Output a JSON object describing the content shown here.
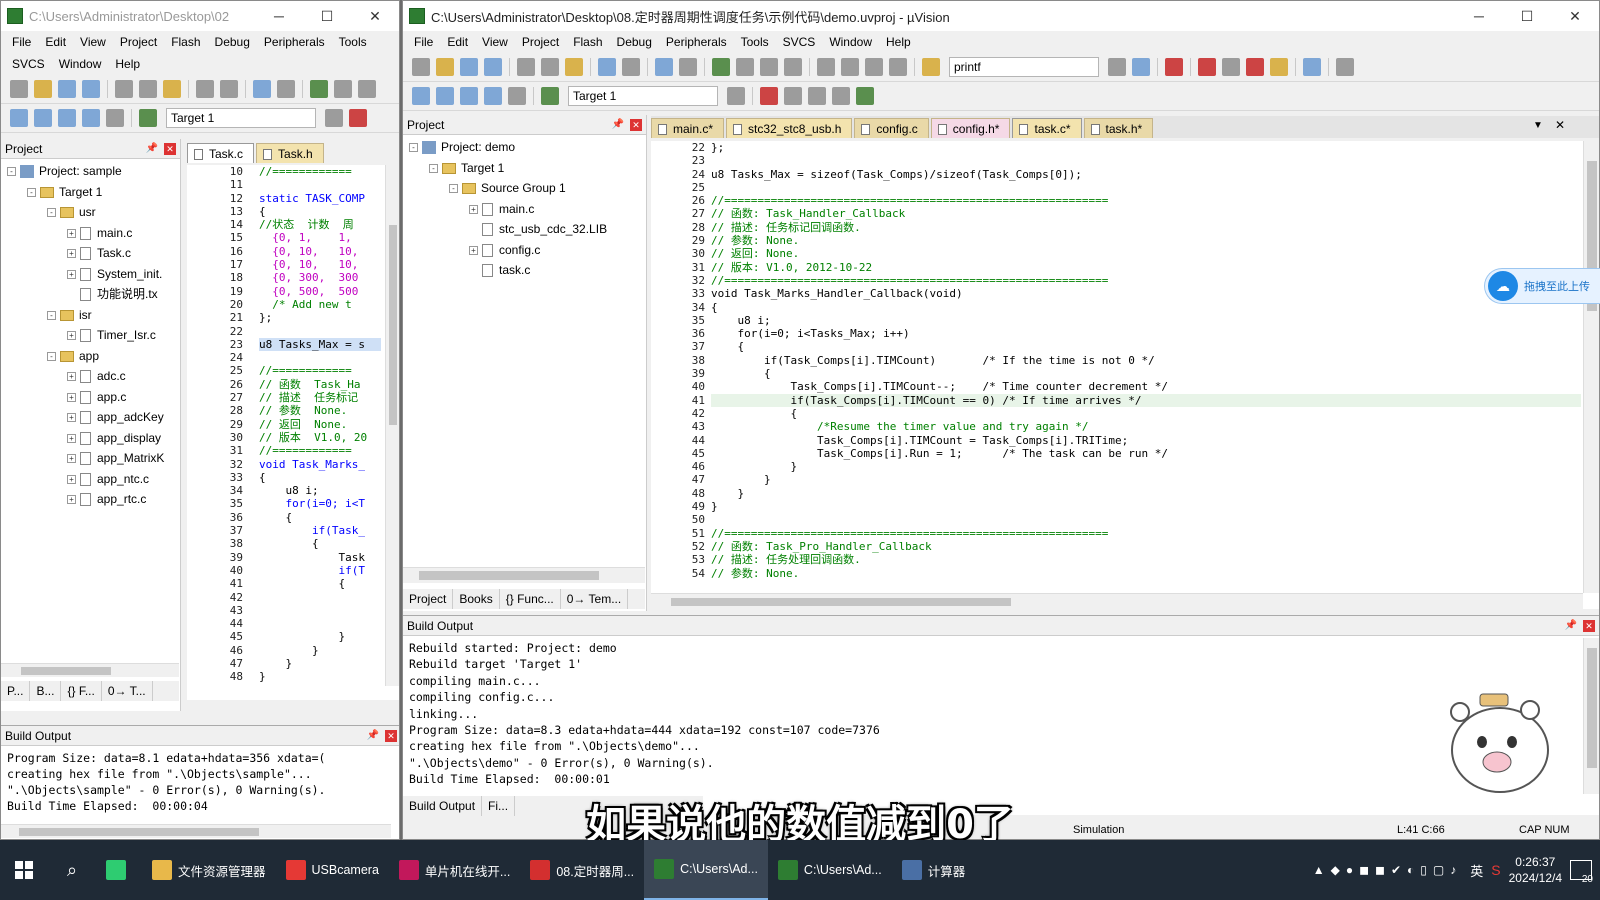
{
  "left_window": {
    "title": "C:\\Users\\Administrator\\Desktop\\02",
    "menu": [
      "File",
      "Edit",
      "View",
      "Project",
      "Flash",
      "Debug",
      "Peripherals",
      "Tools",
      "SVCS",
      "Window",
      "Help"
    ],
    "target": "Target 1",
    "project_panel_title": "Project",
    "tree": [
      {
        "label": "Project: sample",
        "level": 0,
        "kind": "proj",
        "exp": "-"
      },
      {
        "label": "Target 1",
        "level": 1,
        "kind": "fold",
        "exp": "-"
      },
      {
        "label": "usr",
        "level": 2,
        "kind": "fold",
        "exp": "-"
      },
      {
        "label": "main.c",
        "level": 3,
        "kind": "file",
        "exp": "+"
      },
      {
        "label": "Task.c",
        "level": 3,
        "kind": "file",
        "exp": "+"
      },
      {
        "label": "System_init.",
        "level": 3,
        "kind": "file",
        "exp": "+"
      },
      {
        "label": "功能说明.tx",
        "level": 3,
        "kind": "file",
        "exp": ""
      },
      {
        "label": "isr",
        "level": 2,
        "kind": "fold",
        "exp": "-"
      },
      {
        "label": "Timer_Isr.c",
        "level": 3,
        "kind": "file",
        "exp": "+"
      },
      {
        "label": "app",
        "level": 2,
        "kind": "fold",
        "exp": "-"
      },
      {
        "label": "adc.c",
        "level": 3,
        "kind": "file",
        "exp": "+"
      },
      {
        "label": "app.c",
        "level": 3,
        "kind": "file",
        "exp": "+"
      },
      {
        "label": "app_adcKey",
        "level": 3,
        "kind": "file",
        "exp": "+"
      },
      {
        "label": "app_display",
        "level": 3,
        "kind": "file",
        "exp": "+"
      },
      {
        "label": "app_MatrixK",
        "level": 3,
        "kind": "file",
        "exp": "+"
      },
      {
        "label": "app_ntc.c",
        "level": 3,
        "kind": "file",
        "exp": "+"
      },
      {
        "label": "app_rtc.c",
        "level": 3,
        "kind": "file",
        "exp": "+"
      }
    ],
    "bottom_tabs": [
      "P...",
      "B...",
      "{} F...",
      "0→ T..."
    ],
    "editor_tabs": [
      "Task.c",
      "Task.h"
    ],
    "code_lines": [
      {
        "n": "10",
        "t": "//============",
        "c": "cm"
      },
      {
        "n": "11",
        "t": "",
        "c": ""
      },
      {
        "n": "12",
        "t": "static TASK_COMP",
        "c": "kw"
      },
      {
        "n": "13",
        "t": "{",
        "c": ""
      },
      {
        "n": "14",
        "t": "//状态  计数  周",
        "c": "cm"
      },
      {
        "n": "15",
        "t": "  {0, 1,    1,",
        "c": "ks"
      },
      {
        "n": "16",
        "t": "  {0, 10,   10,",
        "c": "ks"
      },
      {
        "n": "17",
        "t": "  {0, 10,   10,",
        "c": "ks"
      },
      {
        "n": "18",
        "t": "  {0, 300,  300",
        "c": "ks"
      },
      {
        "n": "19",
        "t": "  {0, 500,  500",
        "c": "ks"
      },
      {
        "n": "20",
        "t": "  /* Add new t",
        "c": "cm"
      },
      {
        "n": "21",
        "t": "};",
        "c": ""
      },
      {
        "n": "22",
        "t": "",
        "c": ""
      },
      {
        "n": "23",
        "t": "u8 Tasks_Max = s",
        "c": "sel"
      },
      {
        "n": "24",
        "t": "",
        "c": ""
      },
      {
        "n": "25",
        "t": "//============",
        "c": "cm"
      },
      {
        "n": "26",
        "t": "// 函数  Task_Ha",
        "c": "cm"
      },
      {
        "n": "27",
        "t": "// 描述  任务标记",
        "c": "cm"
      },
      {
        "n": "28",
        "t": "// 参数  None.",
        "c": "cm"
      },
      {
        "n": "29",
        "t": "// 返回  None.",
        "c": "cm"
      },
      {
        "n": "30",
        "t": "// 版本  V1.0, 20",
        "c": "cm"
      },
      {
        "n": "31",
        "t": "//============",
        "c": "cm"
      },
      {
        "n": "32",
        "t": "void Task_Marks_",
        "c": "kw"
      },
      {
        "n": "33",
        "t": "{",
        "c": ""
      },
      {
        "n": "34",
        "t": "    u8 i;",
        "c": ""
      },
      {
        "n": "35",
        "t": "    for(i=0; i<T",
        "c": "kw"
      },
      {
        "n": "36",
        "t": "    {",
        "c": ""
      },
      {
        "n": "37",
        "t": "        if(Task_",
        "c": "kw"
      },
      {
        "n": "38",
        "t": "        {",
        "c": ""
      },
      {
        "n": "39",
        "t": "            Task",
        "c": ""
      },
      {
        "n": "40",
        "t": "            if(T",
        "c": "kw"
      },
      {
        "n": "41",
        "t": "            {",
        "c": ""
      },
      {
        "n": "42",
        "t": "",
        "c": ""
      },
      {
        "n": "43",
        "t": "",
        "c": ""
      },
      {
        "n": "44",
        "t": "",
        "c": ""
      },
      {
        "n": "45",
        "t": "            }",
        "c": ""
      },
      {
        "n": "46",
        "t": "        }",
        "c": ""
      },
      {
        "n": "47",
        "t": "    }",
        "c": ""
      },
      {
        "n": "48",
        "t": "}",
        "c": ""
      }
    ],
    "build_title": "Build Output",
    "build_lines": [
      "Program Size: data=8.1 edata+hdata=356 xdata=(",
      "creating hex file from \".\\Objects\\sample\"...",
      "\".\\Objects\\sample\" - 0 Error(s), 0 Warning(s).",
      "Build Time Elapsed:  00:00:04"
    ]
  },
  "right_window": {
    "title": "C:\\Users\\Administrator\\Desktop\\08.定时器周期性调度任务\\示例代码\\demo.uvproj - µVision",
    "menu": [
      "File",
      "Edit",
      "View",
      "Project",
      "Flash",
      "Debug",
      "Peripherals",
      "Tools",
      "SVCS",
      "Window",
      "Help"
    ],
    "find_combo": "printf",
    "target": "Target 1",
    "project_panel_title": "Project",
    "tree": [
      {
        "label": "Project: demo",
        "level": 0,
        "kind": "proj",
        "exp": "-"
      },
      {
        "label": "Target 1",
        "level": 1,
        "kind": "fold",
        "exp": "-"
      },
      {
        "label": "Source Group 1",
        "level": 2,
        "kind": "fold",
        "exp": "-"
      },
      {
        "label": "main.c",
        "level": 3,
        "kind": "file",
        "exp": "+"
      },
      {
        "label": "stc_usb_cdc_32.LIB",
        "level": 3,
        "kind": "file",
        "exp": ""
      },
      {
        "label": "config.c",
        "level": 3,
        "kind": "file",
        "exp": "+"
      },
      {
        "label": "task.c",
        "level": 3,
        "kind": "file",
        "exp": ""
      }
    ],
    "bottom_tabs": [
      "Project",
      "Books",
      "{} Func...",
      "0→ Tem..."
    ],
    "editor_tabs": [
      "main.c*",
      "stc32_stc8_usb.h",
      "config.c",
      "config.h*",
      "task.c*",
      "task.h*"
    ],
    "code_lines": [
      {
        "n": "22",
        "t": "};",
        "c": ""
      },
      {
        "n": "23",
        "t": "",
        "c": ""
      },
      {
        "n": "24",
        "t": "u8 Tasks_Max = sizeof(Task_Comps)/sizeof(Task_Comps[0]);",
        "c": ""
      },
      {
        "n": "25",
        "t": "",
        "c": ""
      },
      {
        "n": "26",
        "t": "//==========================================================",
        "c": "cm"
      },
      {
        "n": "27",
        "t": "// 函数: Task_Handler_Callback",
        "c": "cm"
      },
      {
        "n": "28",
        "t": "// 描述: 任务标记回调函数.",
        "c": "cm"
      },
      {
        "n": "29",
        "t": "// 参数: None.",
        "c": "cm"
      },
      {
        "n": "30",
        "t": "// 返回: None.",
        "c": "cm"
      },
      {
        "n": "31",
        "t": "// 版本: V1.0, 2012-10-22",
        "c": "cm"
      },
      {
        "n": "32",
        "t": "//==========================================================",
        "c": "cm"
      },
      {
        "n": "33",
        "t": "void Task_Marks_Handler_Callback(void)",
        "c": ""
      },
      {
        "n": "34",
        "t": "{",
        "c": ""
      },
      {
        "n": "35",
        "t": "    u8 i;",
        "c": ""
      },
      {
        "n": "36",
        "t": "    for(i=0; i<Tasks_Max; i++)",
        "c": ""
      },
      {
        "n": "37",
        "t": "    {",
        "c": ""
      },
      {
        "n": "38",
        "t": "        if(Task_Comps[i].TIMCount)       /* If the time is not 0 */",
        "c": ""
      },
      {
        "n": "39",
        "t": "        {",
        "c": ""
      },
      {
        "n": "40",
        "t": "            Task_Comps[i].TIMCount--;    /* Time counter decrement */",
        "c": ""
      },
      {
        "n": "41",
        "t": "            if(Task_Comps[i].TIMCount == 0) /* If time arrives */",
        "c": "hl"
      },
      {
        "n": "42",
        "t": "            {",
        "c": ""
      },
      {
        "n": "43",
        "t": "                /*Resume the timer value and try again */",
        "c": "cm"
      },
      {
        "n": "44",
        "t": "                Task_Comps[i].TIMCount = Task_Comps[i].TRITime;",
        "c": ""
      },
      {
        "n": "45",
        "t": "                Task_Comps[i].Run = 1;      /* The task can be run */",
        "c": ""
      },
      {
        "n": "46",
        "t": "            }",
        "c": ""
      },
      {
        "n": "47",
        "t": "        }",
        "c": ""
      },
      {
        "n": "48",
        "t": "    }",
        "c": ""
      },
      {
        "n": "49",
        "t": "}",
        "c": ""
      },
      {
        "n": "50",
        "t": "",
        "c": ""
      },
      {
        "n": "51",
        "t": "//==========================================================",
        "c": "cm"
      },
      {
        "n": "52",
        "t": "// 函数: Task_Pro_Handler_Callback",
        "c": "cm"
      },
      {
        "n": "53",
        "t": "// 描述: 任务处理回调函数.",
        "c": "cm"
      },
      {
        "n": "54",
        "t": "// 参数: None.",
        "c": "cm"
      }
    ],
    "build_title": "Build Output",
    "build_lines": [
      "Rebuild started: Project: demo",
      "Rebuild target 'Target 1'",
      "compiling main.c...",
      "compiling config.c...",
      "linking...",
      "Program Size: data=8.3 edata+hdata=444 xdata=192 const=107 code=7376",
      "creating hex file from \".\\Objects\\demo\"...",
      "\".\\Objects\\demo\" - 0 Error(s), 0 Warning(s).",
      "Build Time Elapsed:  00:00:01"
    ],
    "build_tabs": [
      "Build Output",
      "Fi..."
    ],
    "status": {
      "mode": "Simulation",
      "pos": "L:41 C:66",
      "caps": "CAP NUM"
    }
  },
  "float_button": {
    "label": "拖拽至此上传"
  },
  "subtitle": "如果说他的数值减到0了",
  "taskbar": {
    "items": [
      {
        "label": "",
        "icon": "green-app-icon",
        "color": "#2ecc71"
      },
      {
        "label": "文件资源管理器",
        "icon": "folder-icon",
        "color": "#e8b84a"
      },
      {
        "label": "USBcamera",
        "icon": "camera-icon",
        "color": "#e53935"
      },
      {
        "label": "单片机在线开...",
        "icon": "tool-icon",
        "color": "#c2185b"
      },
      {
        "label": "08.定时器周...",
        "icon": "wps-icon",
        "color": "#d32f2f"
      },
      {
        "label": "C:\\Users\\Ad...",
        "icon": "uvision-icon",
        "color": "#2e7d32",
        "active": true
      },
      {
        "label": "C:\\Users\\Ad...",
        "icon": "uvision-icon",
        "color": "#2e7d32"
      },
      {
        "label": "计算器",
        "icon": "calculator-icon",
        "color": "#4a6fa5"
      }
    ],
    "ime": "英",
    "time": "0:26:37",
    "date": "2024/12/4",
    "notif_count": "20"
  }
}
